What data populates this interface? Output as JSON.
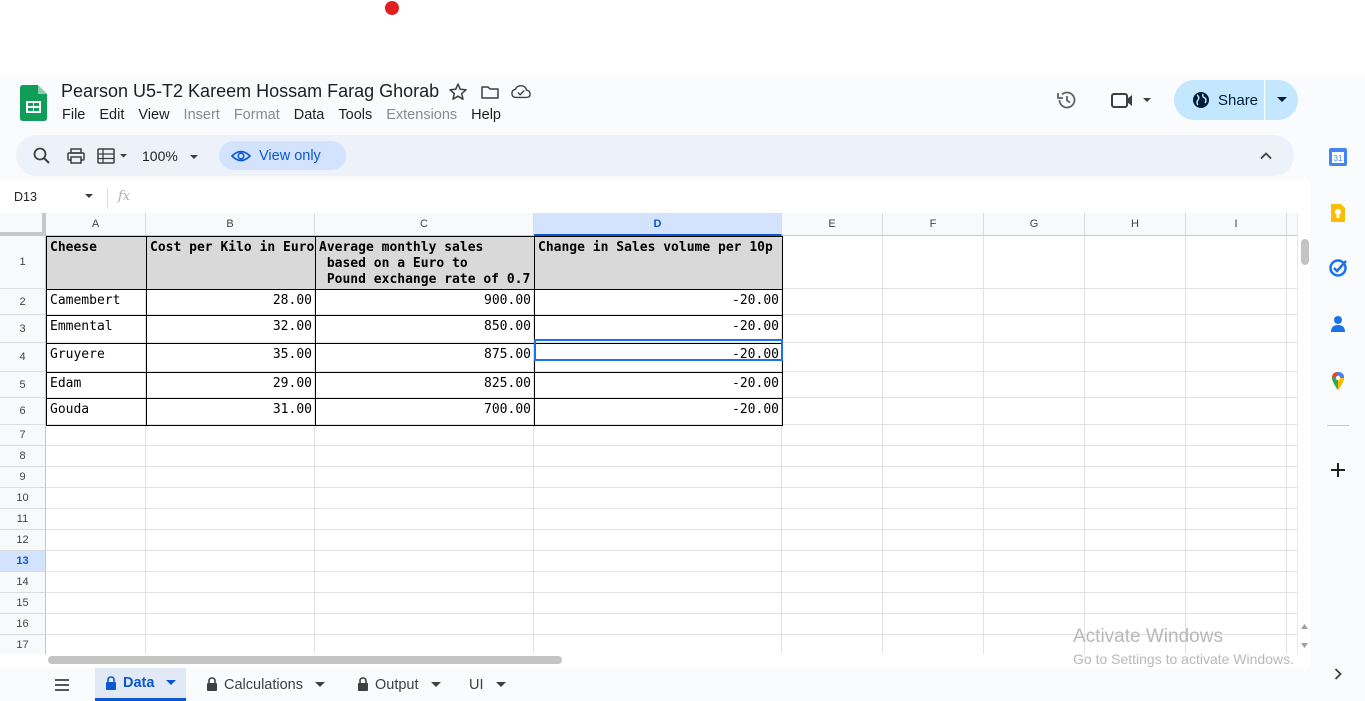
{
  "doc": {
    "title": "Pearson U5-T2 Kareem Hossam Farag Ghorab"
  },
  "menu": [
    {
      "label": "File",
      "disabled": false
    },
    {
      "label": "Edit",
      "disabled": false
    },
    {
      "label": "View",
      "disabled": false
    },
    {
      "label": "Insert",
      "disabled": true
    },
    {
      "label": "Format",
      "disabled": true
    },
    {
      "label": "Data",
      "disabled": false
    },
    {
      "label": "Tools",
      "disabled": false
    },
    {
      "label": "Extensions",
      "disabled": true
    },
    {
      "label": "Help",
      "disabled": false
    }
  ],
  "header": {
    "share_label": "Share"
  },
  "toolbar": {
    "zoom": "100%",
    "view_only_label": "View only"
  },
  "formula_bar": {
    "name_box": "D13",
    "fx_label": "fx"
  },
  "grid": {
    "columns": [
      "A",
      "B",
      "C",
      "D",
      "E",
      "F",
      "G",
      "H",
      "I"
    ],
    "rows": [
      "1",
      "2",
      "3",
      "4",
      "5",
      "6",
      "7",
      "8",
      "9",
      "10",
      "11",
      "12",
      "13",
      "14",
      "15",
      "16",
      "17"
    ],
    "selected_column": "D",
    "selected_row": "13",
    "header_cells": [
      "Cheese",
      "Cost per Kilo in Euros",
      "Average monthly sales\n based on a Euro to\n Pound exchange rate of 0.7",
      "Change in Sales volume per 10p"
    ],
    "data_rows": [
      {
        "cheese": "Camembert",
        "cost": "28.00",
        "sales": "900.00",
        "change": "-20.00"
      },
      {
        "cheese": "Emmental",
        "cost": "32.00",
        "sales": "850.00",
        "change": "-20.00"
      },
      {
        "cheese": "Gruyere",
        "cost": "35.00",
        "sales": "875.00",
        "change": "-20.00"
      },
      {
        "cheese": "Edam",
        "cost": "29.00",
        "sales": "825.00",
        "change": "-20.00"
      },
      {
        "cheese": "Gouda",
        "cost": "31.00",
        "sales": "700.00",
        "change": "-20.00"
      }
    ]
  },
  "sheet_tabs": [
    {
      "label": "Data",
      "locked": true,
      "active": true
    },
    {
      "label": "Calculations",
      "locked": true,
      "active": false
    },
    {
      "label": "Output",
      "locked": true,
      "active": false
    },
    {
      "label": "UI",
      "locked": false,
      "active": false
    }
  ],
  "watermark": {
    "title": "Activate Windows",
    "subtitle": "Go to Settings to activate Windows."
  },
  "side_panel": {
    "calendar_day": "31"
  },
  "colors": {
    "accent": "#0b57d0",
    "share_bg": "#c2e7ff",
    "sheets_green": "#0f9d58"
  }
}
